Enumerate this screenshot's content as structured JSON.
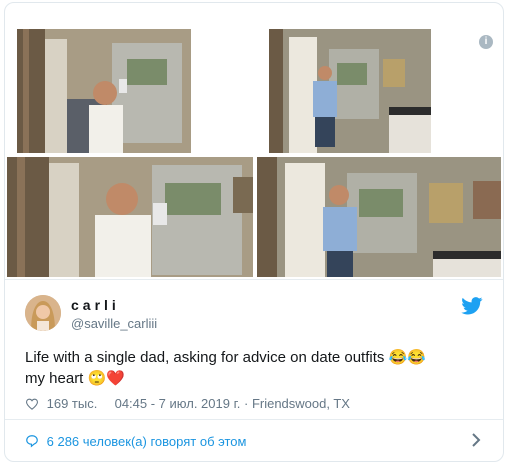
{
  "tweet": {
    "name": "carli",
    "handle": "@saville_carliii",
    "text_line1": "Life with a single dad, asking for advice on date outfits 😂😂",
    "text_line2": "my heart 🙄❤️",
    "likes": "169 тыс.",
    "timestamp": "04:45 - 7 июл. 2019 г.",
    "location": "Friendswood, TX",
    "footer": "6 286 человек(а) говорят об этом"
  },
  "icons": {
    "info": "info-icon",
    "bird": "twitter-bird-icon",
    "heart": "heart-outline-icon",
    "chevron": "chevron-right-icon"
  },
  "colors": {
    "accent": "#1da1f2",
    "link": "#1b95e0",
    "muted": "#657786",
    "text": "#14171a"
  }
}
